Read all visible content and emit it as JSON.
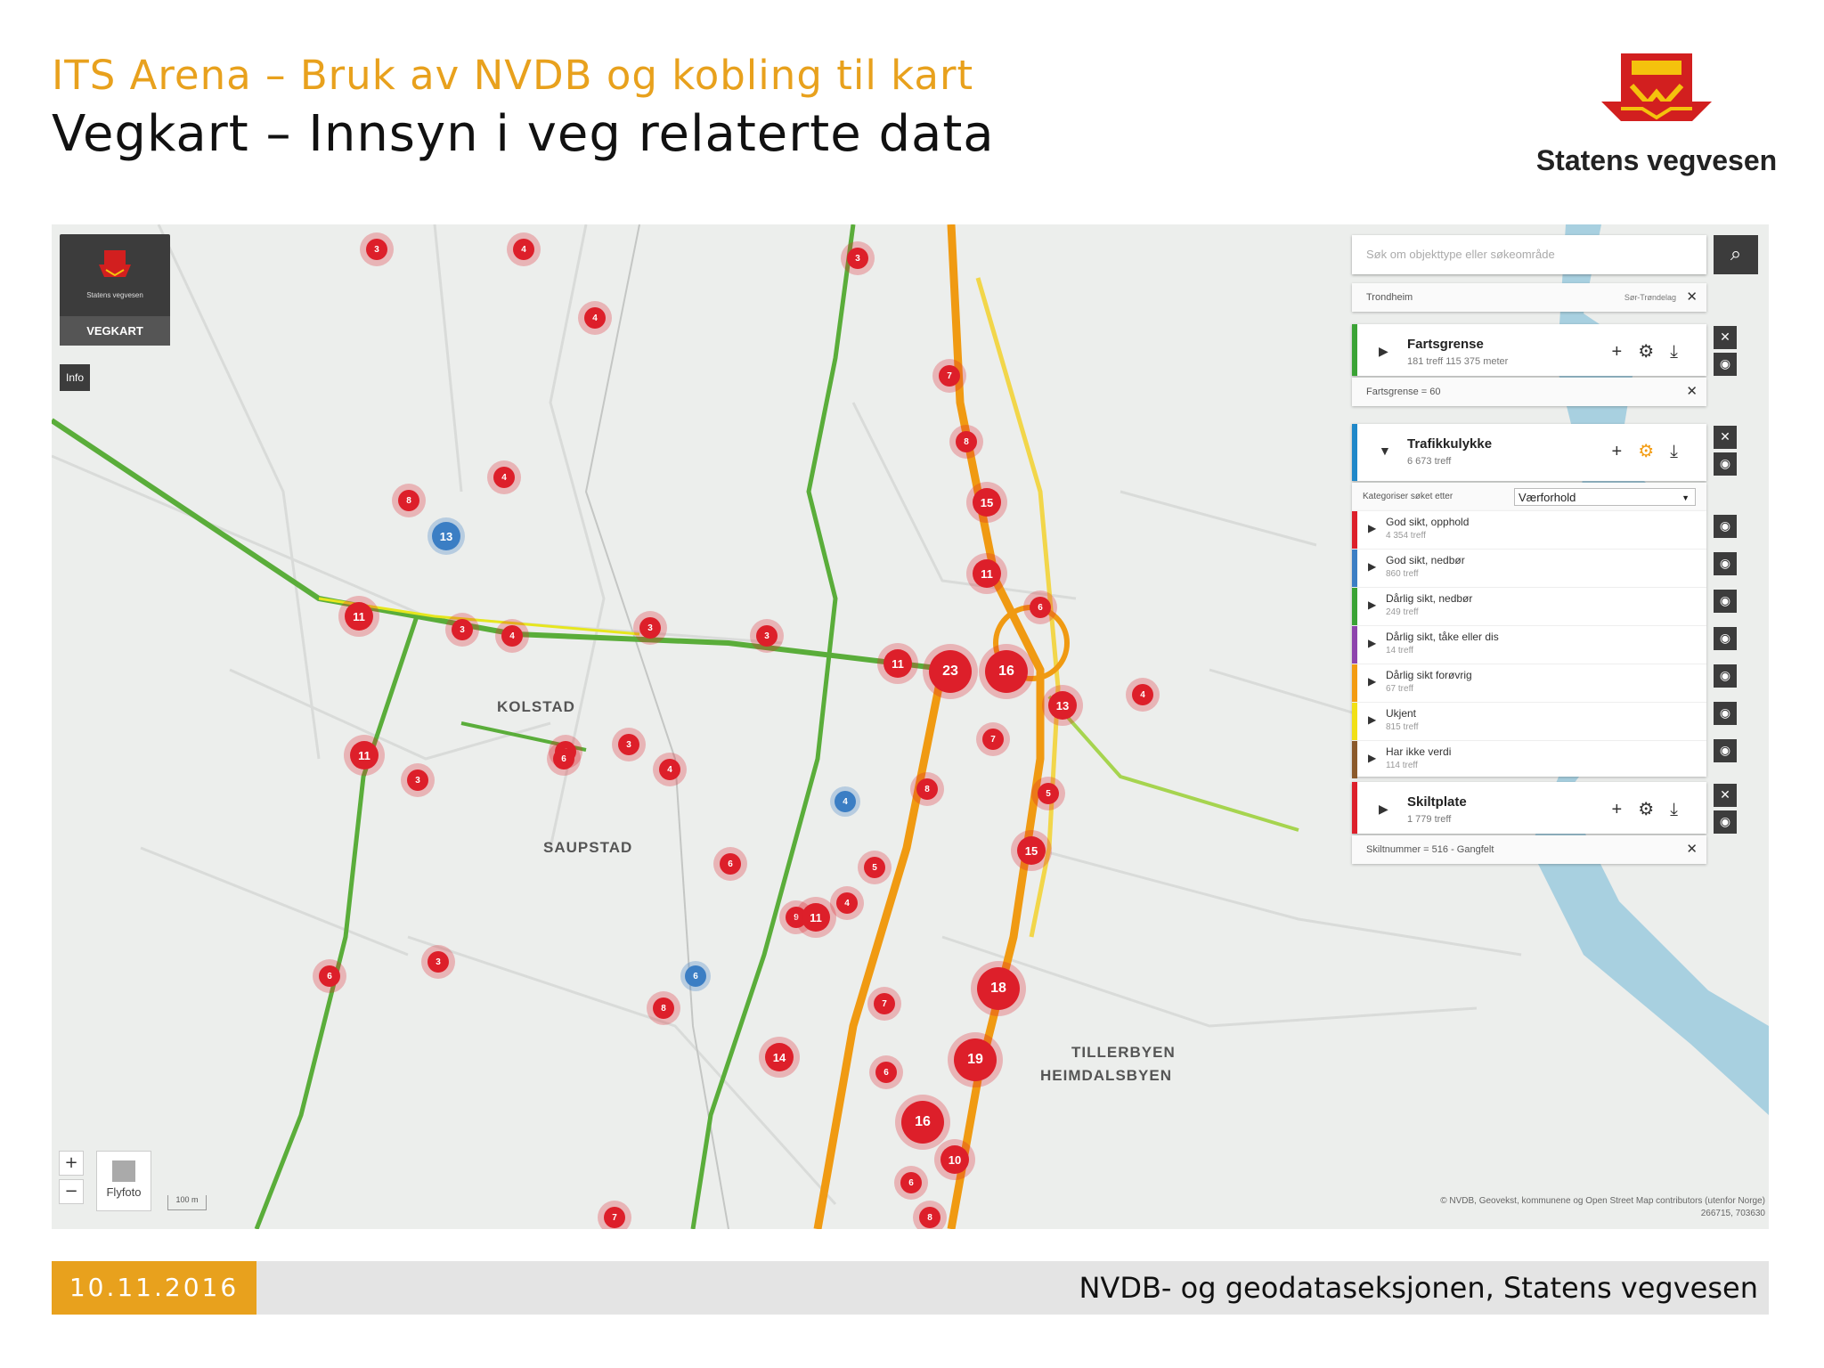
{
  "slide": {
    "subtitle": "ITS Arena – Bruk av NVDB og kobling til kart",
    "title": "Vegkart – Innsyn i veg relaterte data",
    "logo_text": "Statens vegvesen",
    "footer_date": "10.11.2016",
    "footer_org": "NVDB- og geodataseksjonen, Statens vegvesen"
  },
  "app": {
    "brand_name": "Statens vegvesen",
    "app_name": "VEGKART",
    "info_label": "Info",
    "search_placeholder": "Søk om objekttype eller søkeområde",
    "area_filter": {
      "value": "Trondheim",
      "county": "Sør-Trøndelag"
    },
    "flyfoto_label": "Flyfoto",
    "scale_label": "100 m",
    "attribution": "© NVDB, Geovekst, kommunene og Open Street Map contributors (utenfor Norge)",
    "coordinates": "266715, 703630"
  },
  "layers": [
    {
      "name": "Fartsgrense",
      "meta": "181 treff   115 375 meter",
      "color": "#3aa335",
      "filter": "Fartsgrense = 60"
    },
    {
      "name": "Trafikkulykke",
      "meta": "6 673 treff",
      "color": "#1f88c9",
      "filter_label": "Kategoriser søket etter",
      "filter_value": "Værforhold"
    },
    {
      "name": "Skiltplate",
      "meta": "1 779 treff",
      "color": "#dd1f2a",
      "filter": "Skiltnummer = 516 - Gangfelt"
    }
  ],
  "categories": [
    {
      "label": "God sikt, opphold",
      "count": "4 354 treff",
      "color": "#dd1f2a"
    },
    {
      "label": "God sikt, nedbør",
      "count": "860 treff",
      "color": "#3b7ec4"
    },
    {
      "label": "Dårlig sikt, nedbør",
      "count": "249 treff",
      "color": "#3aa335"
    },
    {
      "label": "Dårlig sikt, tåke eller dis",
      "count": "14 treff",
      "color": "#8e44ad"
    },
    {
      "label": "Dårlig sikt forøvrig",
      "count": "67 treff",
      "color": "#f39c12"
    },
    {
      "label": "Ukjent",
      "count": "815 treff",
      "color": "#f1e016"
    },
    {
      "label": "Har ikke verdi",
      "count": "114 treff",
      "color": "#8b5a2b"
    }
  ],
  "places": [
    "KOLSTAD",
    "SAUPSTAD",
    "TILLERBYEN",
    "HEIMDALSBYEN"
  ],
  "clusters": [
    "3",
    "4",
    "3",
    "4",
    "7",
    "8",
    "15",
    "11",
    "8",
    "13",
    "4",
    "11",
    "3",
    "4",
    "3",
    "3",
    "6",
    "11",
    "23",
    "16",
    "13",
    "7",
    "5",
    "6",
    "11",
    "3",
    "4",
    "6",
    "3",
    "4",
    "5",
    "6",
    "8",
    "15",
    "9",
    "11",
    "4",
    "6",
    "3",
    "6",
    "8",
    "18",
    "14",
    "7",
    "19",
    "6",
    "16",
    "10",
    "6",
    "8",
    "7",
    "4"
  ]
}
